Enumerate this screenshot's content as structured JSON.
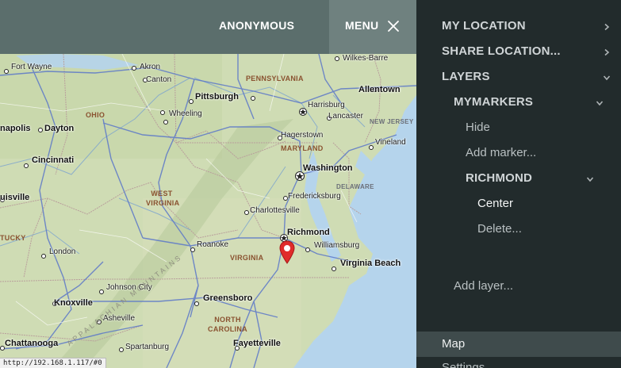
{
  "topbar": {
    "user_label": "ANONYMOUS",
    "menu_label": "MENU",
    "menu_icon": "close-icon"
  },
  "status_url": "http://192.168.1.117/#0",
  "map": {
    "cities": [
      "Fort Wayne",
      "Akron",
      "Canton",
      "Wilkes-Barre",
      "Allentown",
      "Pittsburgh",
      "Harrisburg",
      "Wheeling",
      "Lancaster",
      "Dayton",
      "Hagerstown",
      "Vineland",
      "Cincinnati",
      "Washington",
      "Fredericksburg",
      "Charlottesville",
      "Richmond",
      "Williamsburg",
      "Roanoke",
      "Virginia Beach",
      "London",
      "Johnson City",
      "Knoxville",
      "Greensboro",
      "Asheville",
      "Chattanooga",
      "Spartanburg",
      "Fayetteville",
      "napolis",
      "uisville"
    ],
    "states": [
      "PENNSYLVANIA",
      "OHIO",
      "NEW JERSEY",
      "MARYLAND",
      "DELAWARE",
      "WEST VIRGINIA",
      "VIRGINIA",
      "TUCKY",
      "NORTH CAROLINA"
    ],
    "mountains": "APPALACHIAN MOUNTAINS",
    "marker_color": "#e02b2b"
  },
  "sidemenu": {
    "my_location": "MY LOCATION",
    "share_location": "SHARE LOCATION...",
    "layers": "LAYERS",
    "mymarkers": "MYMARKERS",
    "hide": "Hide",
    "add_marker": "Add marker...",
    "richmond": "RICHMOND",
    "center": "Center",
    "delete": "Delete...",
    "add_layer": "Add layer...",
    "map": "Map",
    "settings": "Settings"
  },
  "colors": {
    "topbar": "#5b6e6c",
    "menu_button": "#6f817f",
    "sidemenu_bg": "#222b2c",
    "selected_item_bg": "#3f4b4c"
  }
}
